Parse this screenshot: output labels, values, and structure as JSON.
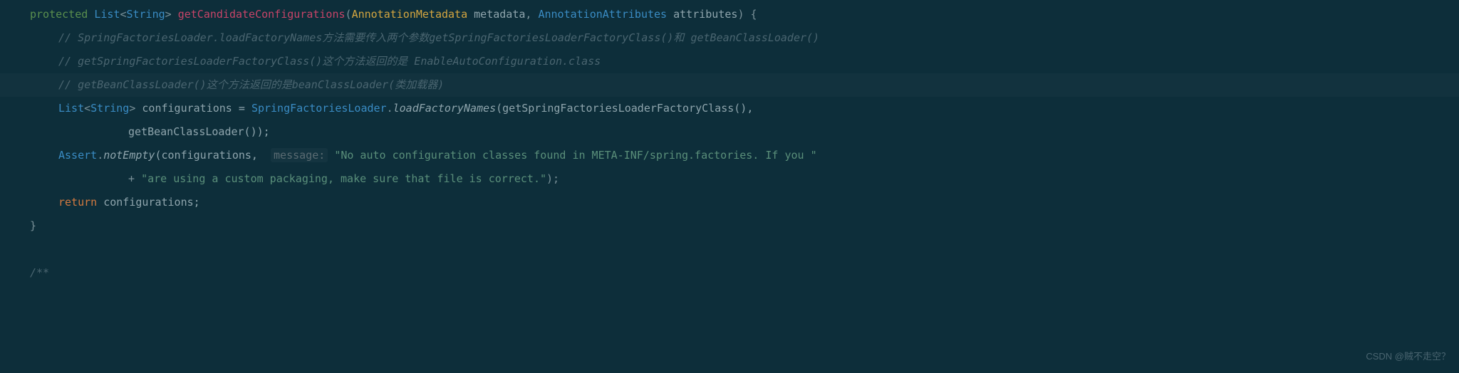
{
  "code": {
    "line1": {
      "kw": "protected",
      "return_type_outer": "List",
      "return_type_inner": "String",
      "method": "getCandidateConfigurations",
      "param1_type": "AnnotationMetadata",
      "param1_name": "metadata",
      "param2_type": "AnnotationAttributes",
      "param2_name": "attributes",
      "brace": " {"
    },
    "comment1": "// SpringFactoriesLoader.loadFactoryNames方法需要传入两个参数getSpringFactoriesLoaderFactoryClass()和 getBeanClassLoader()",
    "comment2": "// getSpringFactoriesLoaderFactoryClass()这个方法返回的是 EnableAutoConfiguration.class",
    "comment3": "// getBeanClassLoader()这个方法返回的是beanClassLoader(类加载器)",
    "line5": {
      "type_outer": "List",
      "type_inner": "String",
      "var": " configurations = ",
      "class_ref": "SpringFactoriesLoader",
      "dot": ".",
      "static_method": "loadFactoryNames",
      "args": "(getSpringFactoriesLoaderFactoryClass(),"
    },
    "line6": "getBeanClassLoader());",
    "line7": {
      "class_ref": "Assert",
      "dot": ".",
      "method": "notEmpty",
      "open": "(configurations, ",
      "hint": "message:",
      "space": " ",
      "string1": "\"No auto configuration classes found in META-INF/spring.factories. If you \""
    },
    "line8": {
      "plus": "+ ",
      "string2": "\"are using a custom packaging, make sure that file is correct.\"",
      "close": ");"
    },
    "line9": {
      "kw": "return",
      "rest": " configurations;"
    },
    "line10": "}",
    "line12": "/**"
  },
  "watermark": "CSDN @贼不走空？"
}
